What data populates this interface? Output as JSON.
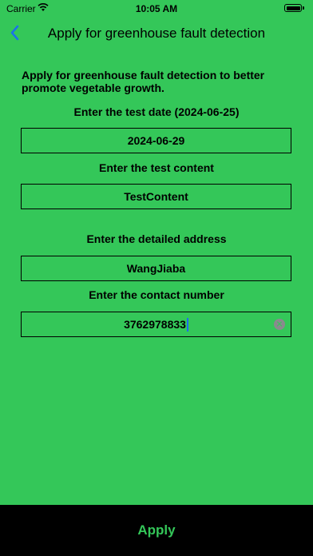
{
  "status_bar": {
    "carrier": "Carrier",
    "time": "10:05 AM"
  },
  "nav": {
    "title": "Apply for greenhouse fault detection"
  },
  "intro": "Apply for greenhouse fault detection to better promote vegetable growth.",
  "form": {
    "test_date": {
      "label": "Enter the test date (2024-06-25)",
      "value": "2024-06-29"
    },
    "test_content": {
      "label": "Enter the test content",
      "value": "TestContent"
    },
    "address": {
      "label": "Enter the detailed address",
      "value": "WangJiaba"
    },
    "contact": {
      "label": "Enter the contact number",
      "value": "3762978833"
    }
  },
  "apply_button": "Apply",
  "colors": {
    "background": "#34c759",
    "accent": "#34c759",
    "footer": "#000000",
    "caret": "#1a6cf0"
  }
}
